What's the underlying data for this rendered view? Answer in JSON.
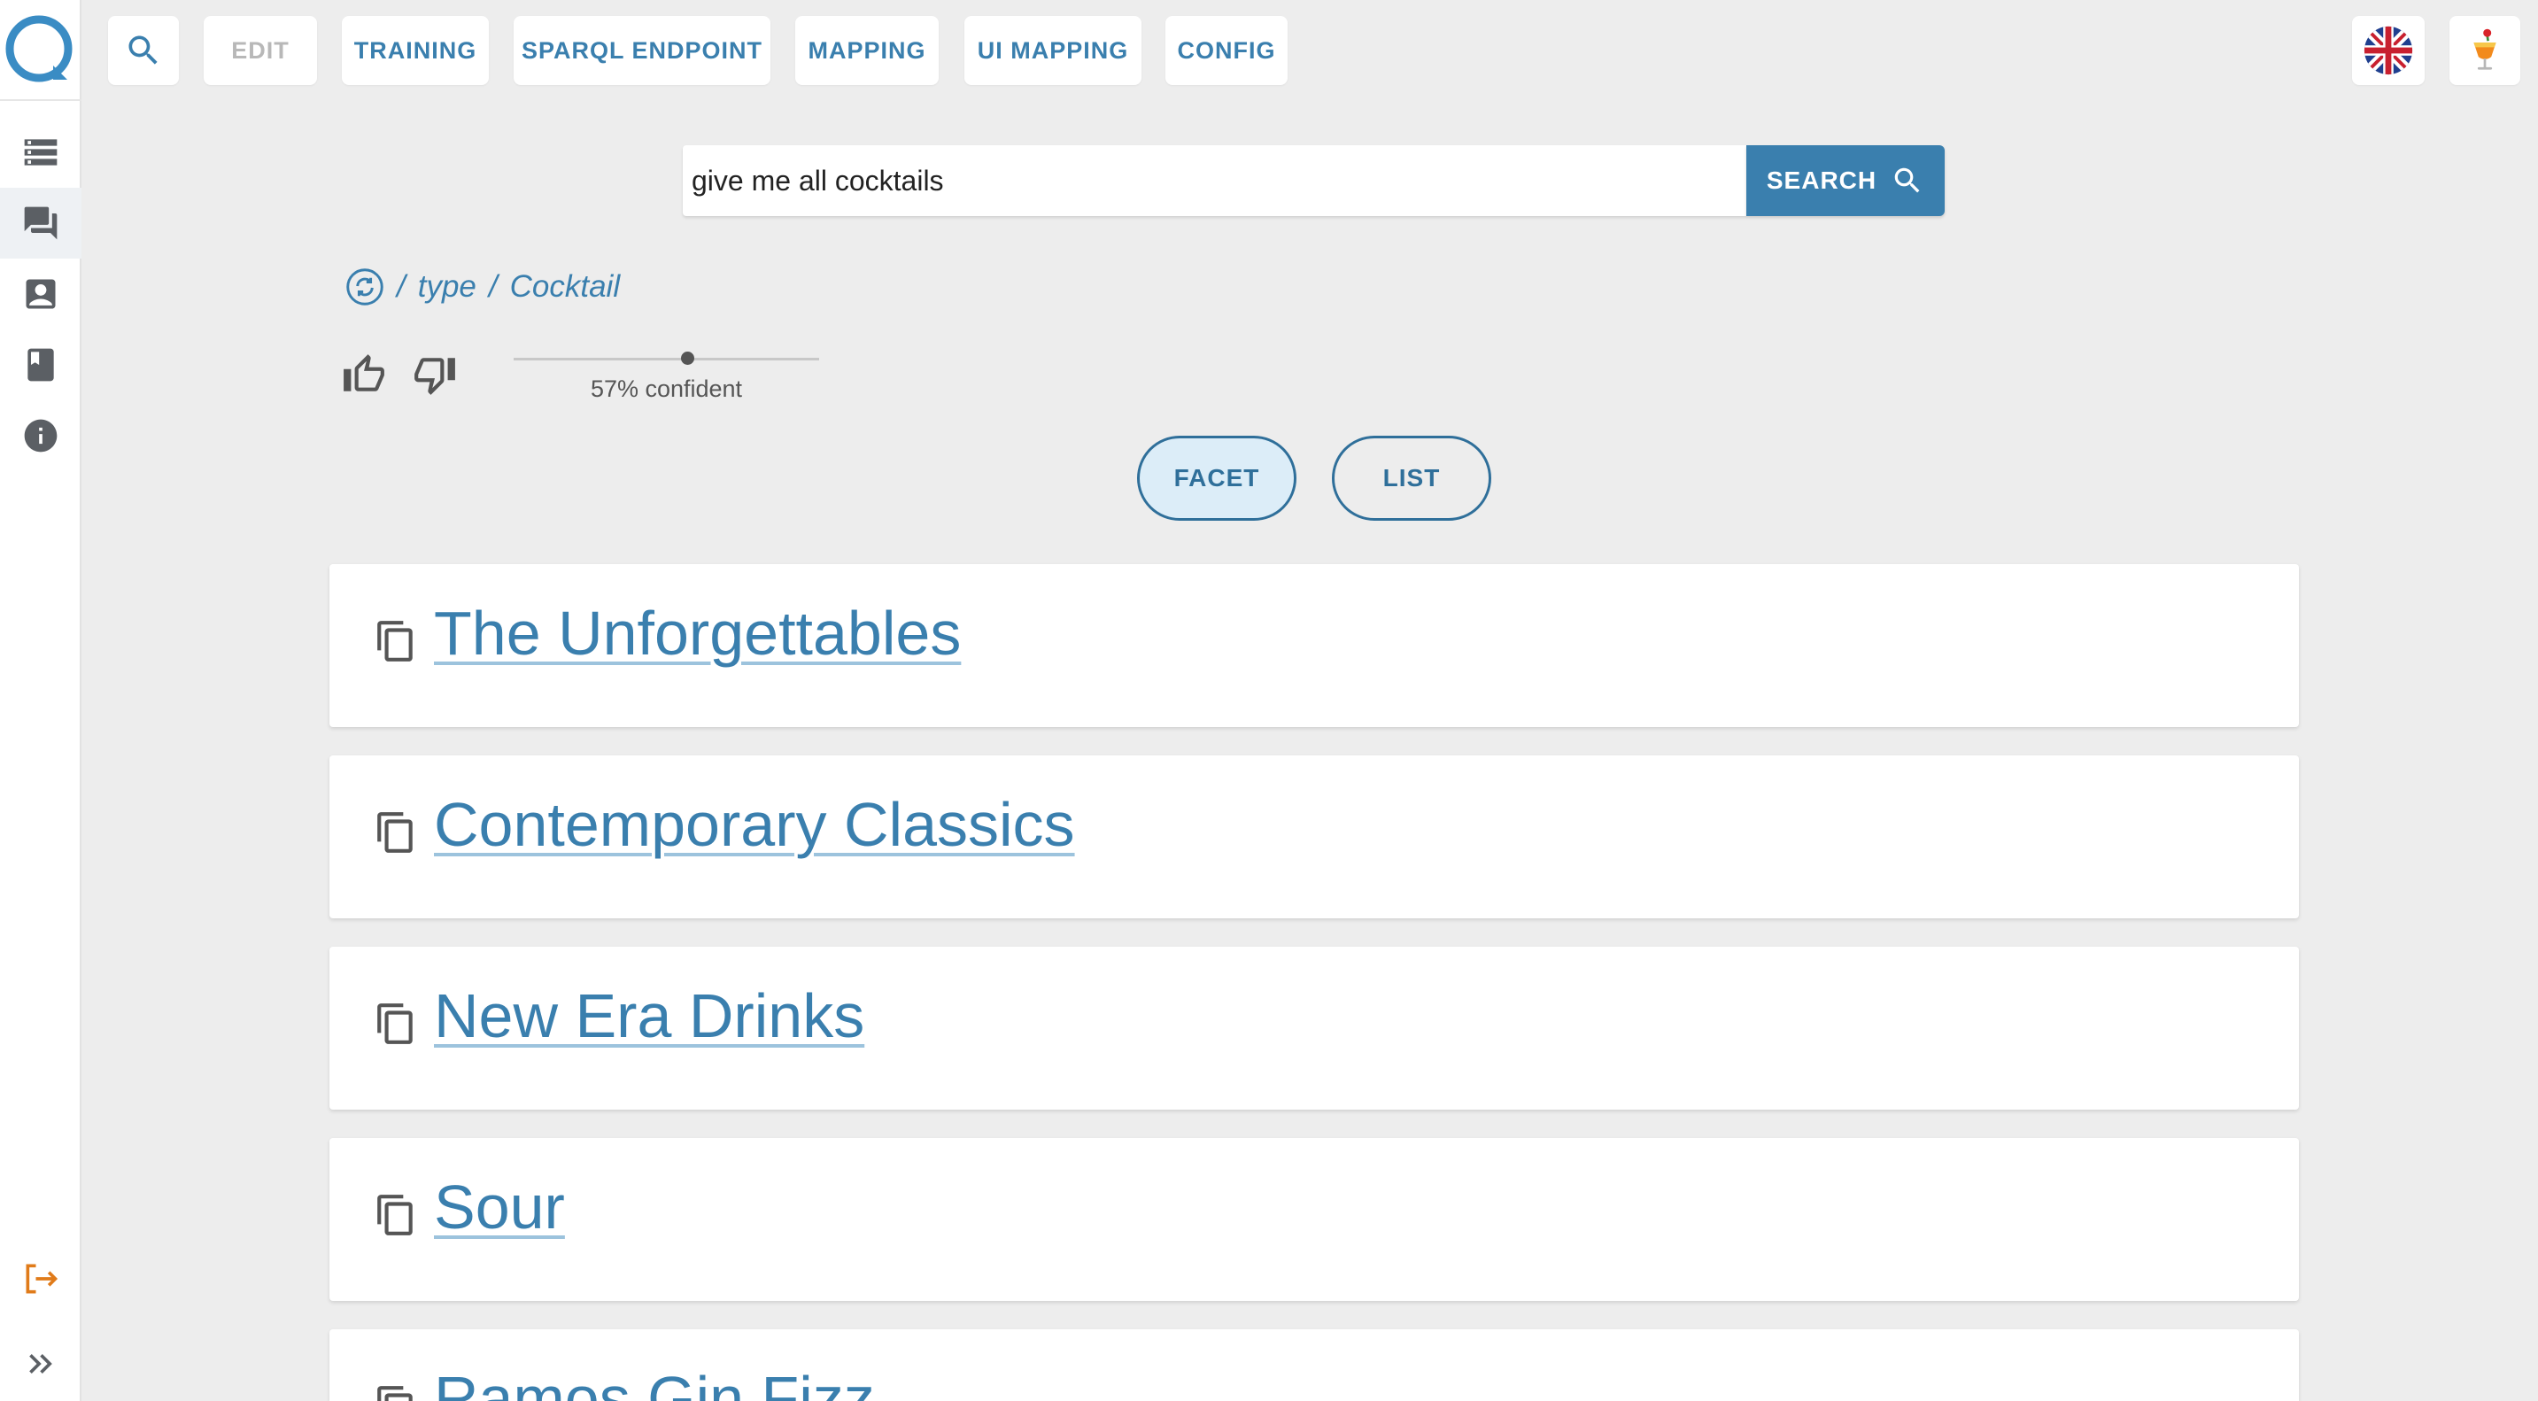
{
  "topbar": {
    "edit_label": "EDIT",
    "training_label": "TRAINING",
    "sparql_label": "SPARQL ENDPOINT",
    "mapping_label": "MAPPING",
    "ui_mapping_label": "UI MAPPING",
    "config_label": "CONFIG"
  },
  "sidebar": {
    "items": [
      {
        "icon": "storage-icon"
      },
      {
        "icon": "chat-icon"
      },
      {
        "icon": "contact-icon"
      },
      {
        "icon": "book-icon"
      },
      {
        "icon": "info-icon"
      }
    ],
    "bottom": [
      {
        "icon": "logout-icon"
      },
      {
        "icon": "expand-icon"
      }
    ]
  },
  "search": {
    "query": "give me all cocktails",
    "button_label": "SEARCH"
  },
  "query_path": {
    "separator1": "/",
    "type": "type",
    "separator2": "/",
    "class": "Cocktail"
  },
  "confidence": {
    "value": 0.57,
    "label": "57% confident"
  },
  "view": {
    "facet_label": "FACET",
    "list_label": "LIST",
    "selected": "FACET"
  },
  "results": [
    {
      "title": "The Unforgettables"
    },
    {
      "title": "Contemporary Classics"
    },
    {
      "title": "New Era Drinks"
    },
    {
      "title": "Sour"
    },
    {
      "title": "Ramos Gin Fizz"
    }
  ],
  "colors": {
    "accent": "#3a7fae",
    "background": "#ededed",
    "logout": "#e07b1a"
  }
}
